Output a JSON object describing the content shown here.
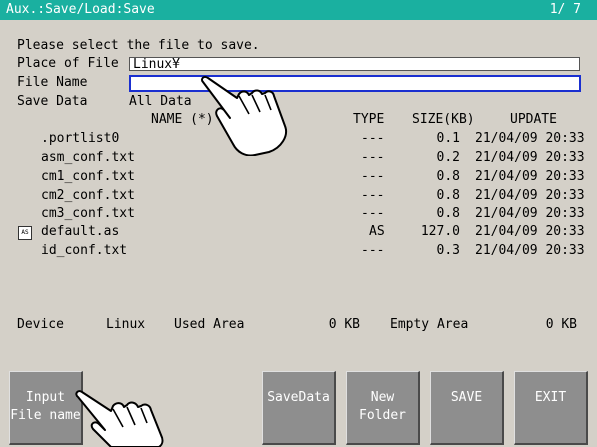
{
  "window": {
    "title": "Aux.:Save/Load:Save",
    "page": "1/ 7"
  },
  "prompt": "Please select the file to save.",
  "place_of_file": {
    "label": "Place of File",
    "value": "Linux¥"
  },
  "file_name": {
    "label": "File Name",
    "value": ""
  },
  "save_data": {
    "label": "Save Data",
    "value": "All Data"
  },
  "columns": {
    "name": "NAME (*)",
    "type": "TYPE",
    "size": "SIZE(KB)",
    "update": "UPDATE"
  },
  "files": [
    {
      "name": ".portlist0",
      "type": "---",
      "size": "0.1",
      "update": "21/04/09 20:33"
    },
    {
      "name": "asm_conf.txt",
      "type": "---",
      "size": "0.2",
      "update": "21/04/09 20:33"
    },
    {
      "name": "cm1_conf.txt",
      "type": "---",
      "size": "0.8",
      "update": "21/04/09 20:33"
    },
    {
      "name": "cm2_conf.txt",
      "type": "---",
      "size": "0.8",
      "update": "21/04/09 20:33"
    },
    {
      "name": "cm3_conf.txt",
      "type": "---",
      "size": "0.8",
      "update": "21/04/09 20:33"
    },
    {
      "name": "default.as",
      "type": "AS",
      "size": "127.0",
      "update": "21/04/09 20:33",
      "icon": "AS"
    },
    {
      "name": "id_conf.txt",
      "type": "---",
      "size": "0.3",
      "update": "21/04/09 20:33"
    }
  ],
  "device": {
    "label": "Device",
    "value": "Linux",
    "used_label": "Used Area",
    "used_value": "0 KB",
    "empty_label": "Empty Area",
    "empty_value": "0 KB"
  },
  "buttons": {
    "input_file_name": "Input\nFile name",
    "save_data": "SaveData",
    "new_folder": "New\nFolder",
    "save": "SAVE",
    "exit": "EXIT"
  },
  "colors": {
    "titlebar": "#1ab0a0",
    "panel": "#d4d0c8",
    "button": "#8e8e8e",
    "focus": "#1a2fd0"
  },
  "icons": [
    "pointing-hand-icon",
    "file-as-icon"
  ]
}
